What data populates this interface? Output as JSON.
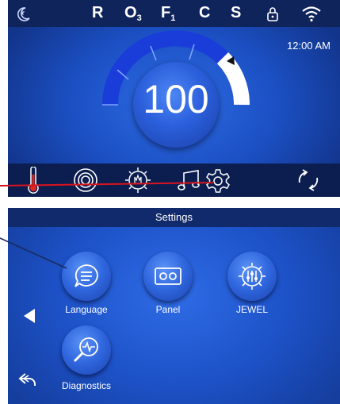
{
  "status_bar": {
    "icons": [
      "moon-icon",
      "lock-icon",
      "wifi-icon"
    ],
    "indicators": [
      {
        "main": "R",
        "sub": ""
      },
      {
        "main": "O",
        "sub": "3"
      },
      {
        "main": "F",
        "sub": "1"
      },
      {
        "main": "C",
        "sub": ""
      },
      {
        "main": "S",
        "sub": ""
      }
    ]
  },
  "time": "12:00 AM",
  "temperature": "100",
  "bottom_bar": {
    "icons": [
      "thermometer-icon",
      "pump-icon",
      "light-icon",
      "music-icon",
      "settings-icon",
      "invert-icon"
    ]
  },
  "settings": {
    "title": "Settings",
    "buttons": {
      "language": "Language",
      "panel": "Panel",
      "jewel": "JEWEL",
      "diagnostics": "Diagnostics"
    }
  },
  "colors": {
    "panel_blue": "#1d4fbd",
    "bar_dark": "#0c1e50",
    "callout_red": "#d8141c",
    "dial_active": "#1a3dd9",
    "dial_inactive": "#ffffff"
  }
}
